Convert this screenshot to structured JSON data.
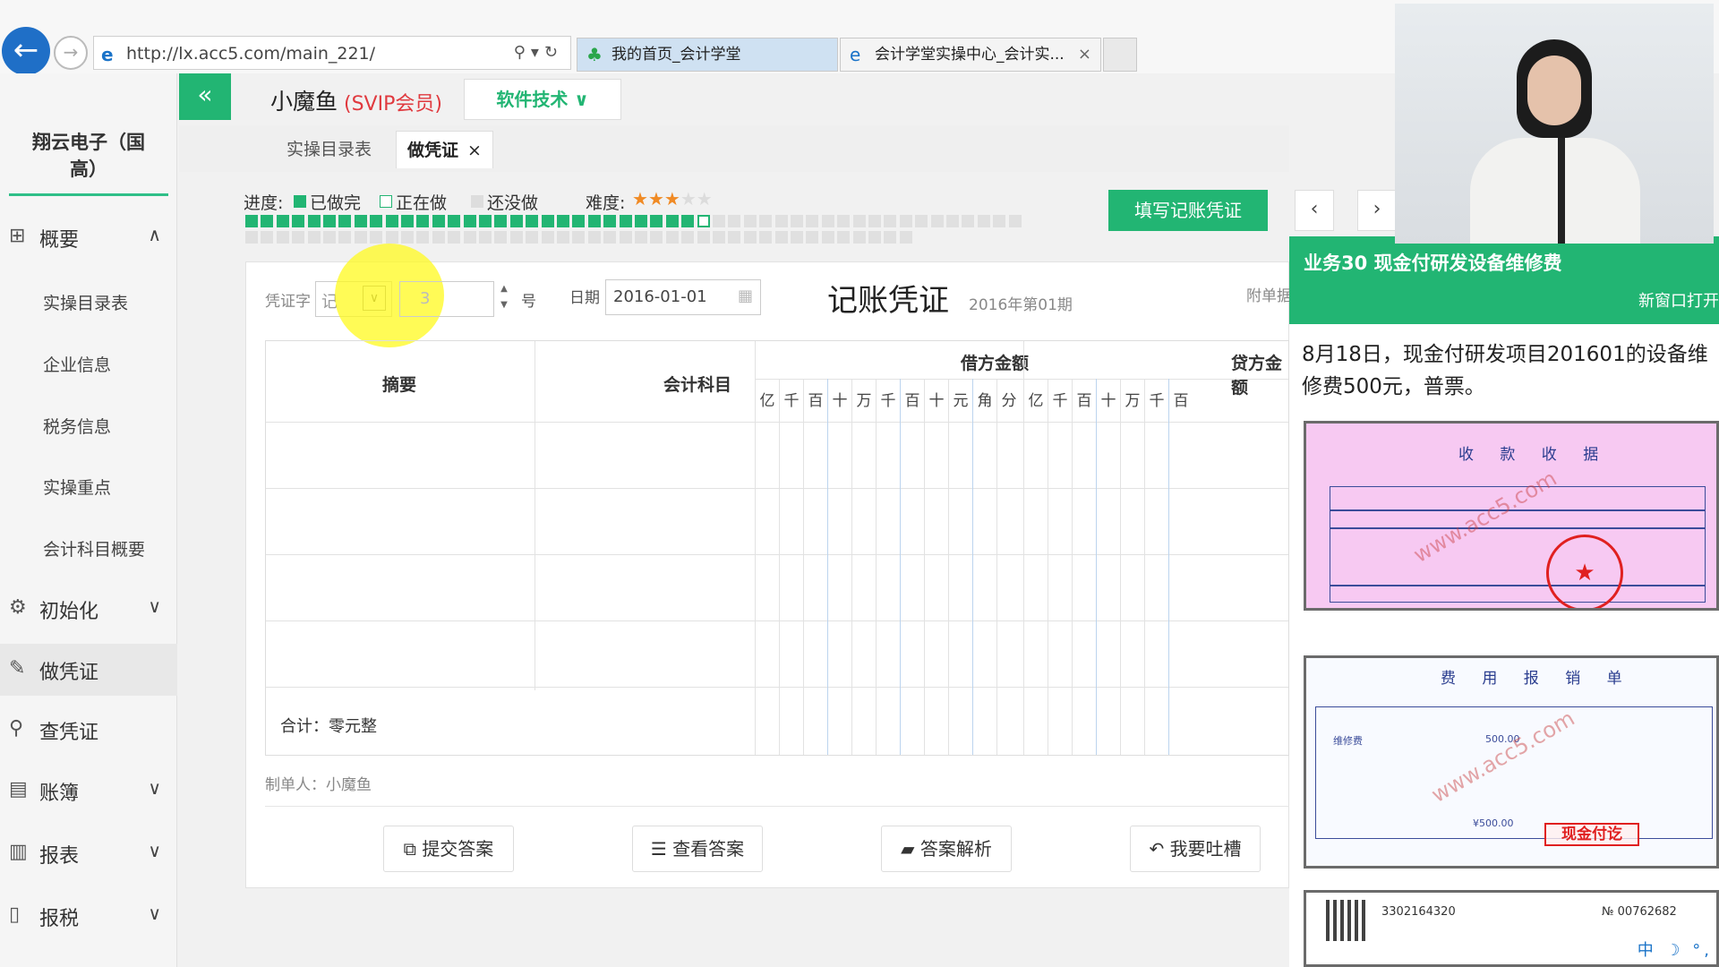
{
  "browser": {
    "url": "http://lx.acc5.com/main_221/",
    "tabs": [
      {
        "label": "我的首页_会计学堂"
      },
      {
        "label": "会计学堂实操中心_会计实..."
      }
    ],
    "close_symbol": "×"
  },
  "sidebar": {
    "company": "翔云电子（国高）",
    "items": [
      {
        "label": "概要",
        "icon": "grid-icon"
      },
      {
        "label": "初始化",
        "icon": "gear-icon"
      },
      {
        "label": "做凭证",
        "icon": "pencil-icon"
      },
      {
        "label": "查凭证",
        "icon": "search-icon"
      },
      {
        "label": "账簿",
        "icon": "book-icon"
      },
      {
        "label": "报表",
        "icon": "report-icon"
      },
      {
        "label": "报税",
        "icon": "file-icon"
      }
    ],
    "sub_items": [
      "实操目录表",
      "企业信息",
      "税务信息",
      "实操重点",
      "会计科目概要"
    ]
  },
  "header": {
    "collapse_symbol": "«",
    "user_name": "小魔鱼",
    "user_badge": "(SVIP会员)",
    "tech_label": "软件技术 ∨"
  },
  "page_tabs": [
    {
      "label": "实操目录表"
    },
    {
      "label": "做凭证",
      "close": "×"
    }
  ],
  "progress": {
    "label": "进度:",
    "legend": [
      "已做完",
      "正在做",
      "还没做"
    ],
    "difficulty_label": "难度:",
    "difficulty": 3,
    "difficulty_max": 5,
    "total_tasks": 100,
    "done_tasks": 29,
    "current_task": 30,
    "colors": {
      "done": "#22b573",
      "current": "#ffffff",
      "todo": "#e0e0e0",
      "star": "#f08a24"
    }
  },
  "buttons": {
    "fill_voucher": "填写记账凭证",
    "prev": "‹",
    "next": "›"
  },
  "voucher": {
    "type_label": "凭证字",
    "type_value": "记",
    "number_value": "3",
    "number_suffix": "号",
    "date_label": "日期",
    "date_value": "2016-01-01",
    "title": "记账凭证",
    "period": "2016年第01期",
    "attach_label": "附单据",
    "columns": {
      "summary": "摘要",
      "account": "会计科目",
      "debit": "借方金额",
      "credit": "贷方金额"
    },
    "digit_units_debit": [
      "亿",
      "千",
      "百",
      "十",
      "万",
      "千",
      "百",
      "十",
      "元",
      "角",
      "分"
    ],
    "digit_units_credit": [
      "亿",
      "千",
      "百",
      "十",
      "万",
      "千",
      "百"
    ],
    "total": "合计：零元整",
    "maker": "制单人：小魔鱼"
  },
  "actions": [
    {
      "label": "提交答案",
      "icon": "external-link-icon",
      "glyph": "⧉"
    },
    {
      "label": "查看答案",
      "icon": "database-icon",
      "glyph": "☰"
    },
    {
      "label": "答案解析",
      "icon": "folder-open-icon",
      "glyph": "▰"
    },
    {
      "label": "我要吐槽",
      "icon": "reply-icon",
      "glyph": "↶"
    }
  ],
  "task": {
    "title": "业务30 现金付研发设备维修费",
    "open_new": "新窗口打开",
    "description": "8月18日，现金付研发项目201601的设备维修费500元，普票。",
    "receipt_title": "收 款 收 据",
    "expense_title": "费 用 报 销 单",
    "expense_item": "维修费",
    "expense_amount": "500.00",
    "expense_total": "¥500.00",
    "cash_stamp": "现金付讫",
    "watermark": "www.acc5.com",
    "invoice_code": "3302164320",
    "invoice_no": "№ 00762682"
  },
  "ime": "中 ☽ °,"
}
